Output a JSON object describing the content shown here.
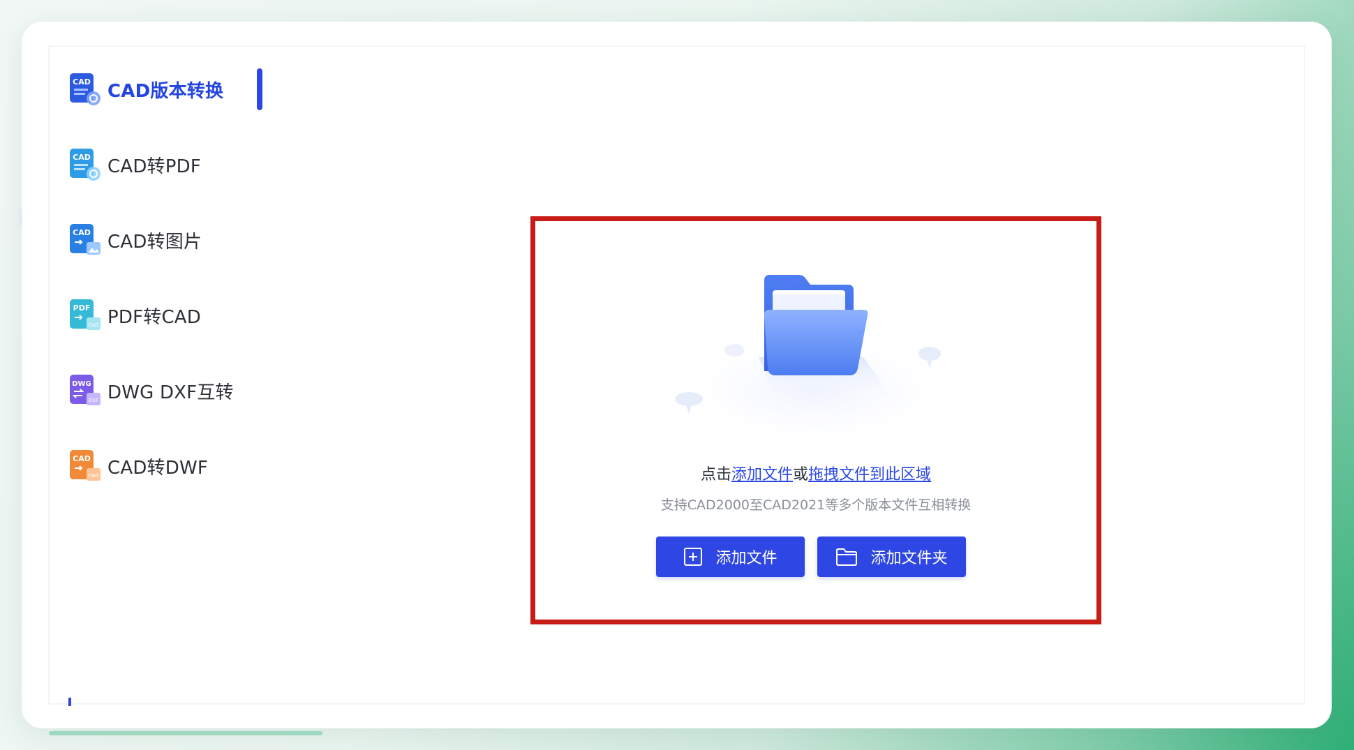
{
  "sidebar": {
    "items": [
      {
        "label": "CAD版本转换",
        "icon_badge": "CAD",
        "icon": "cad-version-icon",
        "color": "#2c5be0",
        "active": true
      },
      {
        "label": "CAD转PDF",
        "icon_badge": "CAD",
        "icon": "cad-to-pdf-icon",
        "color": "#2d9be6",
        "active": false
      },
      {
        "label": "CAD转图片",
        "icon_badge": "CAD",
        "icon": "cad-to-image-icon",
        "color": "#2a7fe3",
        "active": false
      },
      {
        "label": "PDF转CAD",
        "icon_badge": "PDF",
        "icon": "pdf-to-cad-icon",
        "color": "#34b9d6",
        "active": false
      },
      {
        "label": "DWG DXF互转",
        "icon_badge": "DWG",
        "icon": "dwg-dxf-icon",
        "color": "#7c5ce6",
        "active": false
      },
      {
        "label": "CAD转DWF",
        "icon_badge": "CAD",
        "icon": "cad-to-dwf-icon",
        "color": "#f08a38",
        "active": false
      }
    ],
    "accent": "#2e47e4"
  },
  "dropzone": {
    "prefix": "点击",
    "link_add": "添加文件",
    "middle": "或",
    "link_drag": "拖拽文件到此区域",
    "hint": "支持CAD2000至CAD2021等多个版本文件互相转换",
    "highlight_color": "#c81d17",
    "folder_icon": "folder-open-icon"
  },
  "buttons": {
    "add_file": "添加文件",
    "add_folder": "添加文件夹",
    "color": "#2e47e4"
  }
}
